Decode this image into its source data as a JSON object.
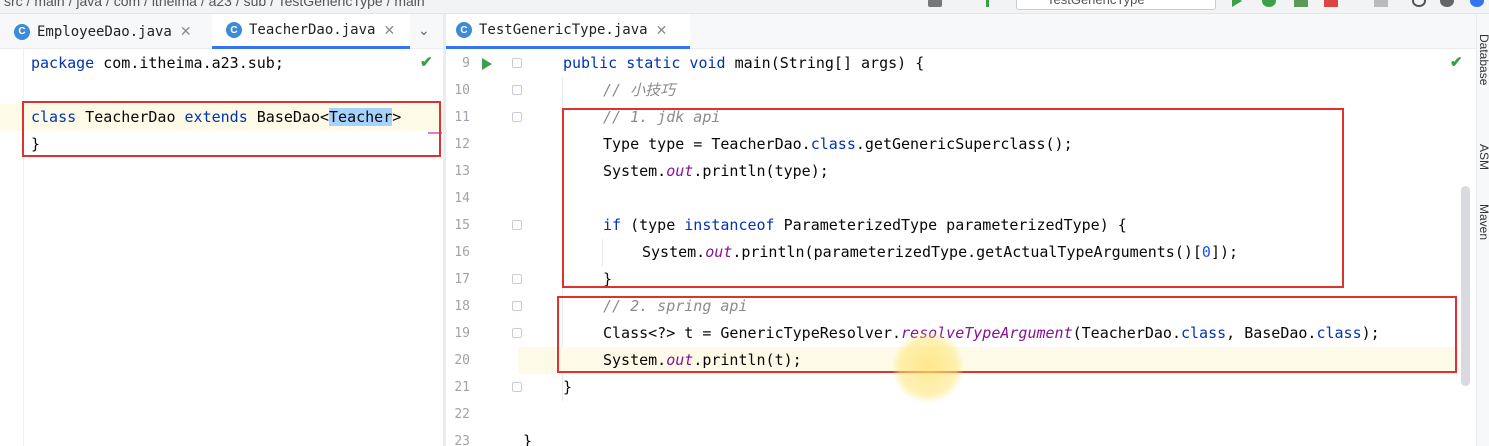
{
  "breadcrumb": "src / main / java / com / itheima / a23 / sub / TestGenericType / main",
  "run_config": "TestGenericType",
  "left_tabs": [
    {
      "label": "EmployeeDao.java",
      "icon": "class-icon",
      "active": false
    },
    {
      "label": "TeacherDao.java",
      "icon": "class-icon",
      "active": true
    }
  ],
  "right_tabs": [
    {
      "label": "TestGenericType.java",
      "icon": "class-icon",
      "active": true
    }
  ],
  "left_code": {
    "l1_kw": "package",
    "l1_rest": " com.itheima.a23.sub;",
    "l3_kw1": "class",
    "l3_t1": " TeacherDao ",
    "l3_kw2": "extends",
    "l3_t2": " BaseDao<",
    "l3_sel": "Teacher",
    "l3_t3": ">",
    "l4": "}"
  },
  "line_numbers": [
    "9",
    "10",
    "11",
    "12",
    "13",
    "14",
    "15",
    "16",
    "17",
    "18",
    "19",
    "20",
    "21",
    "22",
    "23"
  ],
  "right_code": {
    "l9_kw": "public static void",
    "l9_rest": " main(String[] args) {",
    "l10": "// 小技巧",
    "l11": "// 1. jdk api",
    "l12_a": "Type type = TeacherDao.",
    "l12_kw": "class",
    "l12_b": ".getGenericSuperclass();",
    "l13_a": "System.",
    "l13_st": "out",
    "l13_b": ".println(type);",
    "l15_kw": "if",
    "l15_a": " (type ",
    "l15_kw2": "instanceof",
    "l15_b": " ParameterizedType parameterizedType) {",
    "l16_a": "System.",
    "l16_st": "out",
    "l16_b": ".println(parameterizedType.getActualTypeArguments()[",
    "l16_num": "0",
    "l16_c": "]);",
    "l17": "}",
    "l18": "// 2. spring api",
    "l19_a": "Class<?> t = GenericTypeResolver.",
    "l19_st": "resolveTypeArgument",
    "l19_b": "(TeacherDao.",
    "l19_kw": "class",
    "l19_c": ", BaseDao.",
    "l19_kw2": "class",
    "l19_d": ");",
    "l20_a": "System.",
    "l20_st": "out",
    "l20_b": ".println(t);",
    "l21": "}",
    "l23": "}"
  },
  "tool_window_labels": [
    "Database",
    "ASM",
    "Maven"
  ],
  "colors": {
    "keyword": "#0033b3",
    "comment": "#8c8c8c",
    "static_field": "#871094",
    "annotation_box": "#e03131",
    "inspection_ok": "#3a9d4a"
  }
}
